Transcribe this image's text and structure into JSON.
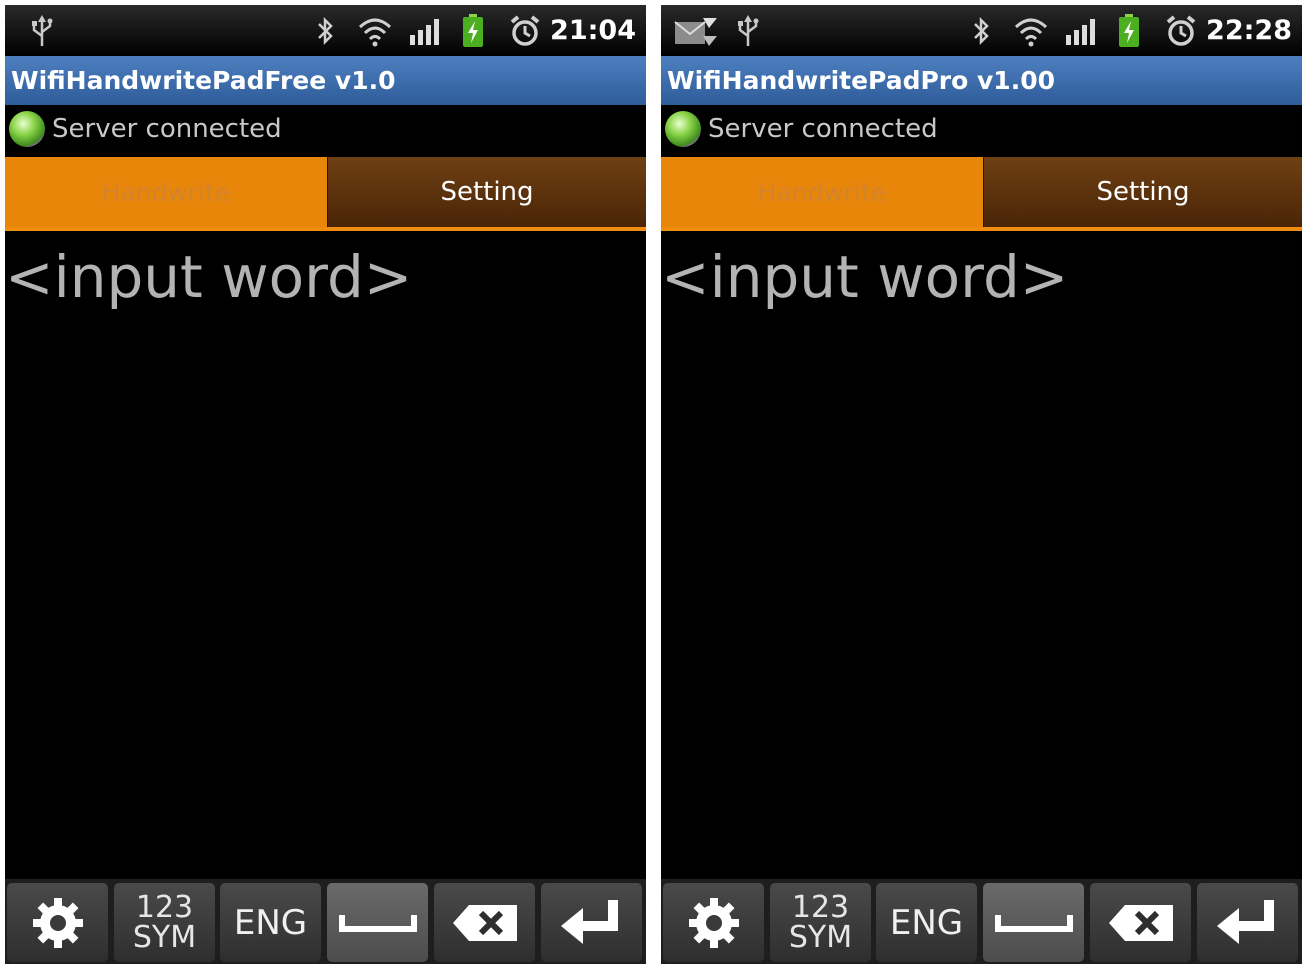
{
  "screens": [
    {
      "status": {
        "time": "21:04",
        "notification_icons": [
          "usb-icon"
        ]
      },
      "app_title": "WifiHandwritePadFree v1.0",
      "connection_status": "Server connected",
      "tabs": [
        {
          "label": "Handwrite",
          "selected": true
        },
        {
          "label": "Setting",
          "selected": false
        }
      ],
      "input_placeholder": "<input word>",
      "keyboard": {
        "sym_top": "123",
        "sym_bottom": "SYM",
        "lang": "ENG"
      }
    },
    {
      "status": {
        "time": "22:28",
        "notification_icons": [
          "message-icon",
          "usb-icon"
        ]
      },
      "app_title": "WifiHandwritePadPro v1.00",
      "connection_status": "Server connected",
      "tabs": [
        {
          "label": "Handwrite",
          "selected": true
        },
        {
          "label": "Setting",
          "selected": false
        }
      ],
      "input_placeholder": "<input word>",
      "keyboard": {
        "sym_top": "123",
        "sym_bottom": "SYM",
        "lang": "ENG"
      }
    }
  ],
  "colors": {
    "title_bar": "#3f6fad",
    "tab_selected": "#e8860a",
    "tab_unselected": "#5a300c",
    "connection_led": "#8ad34a"
  }
}
